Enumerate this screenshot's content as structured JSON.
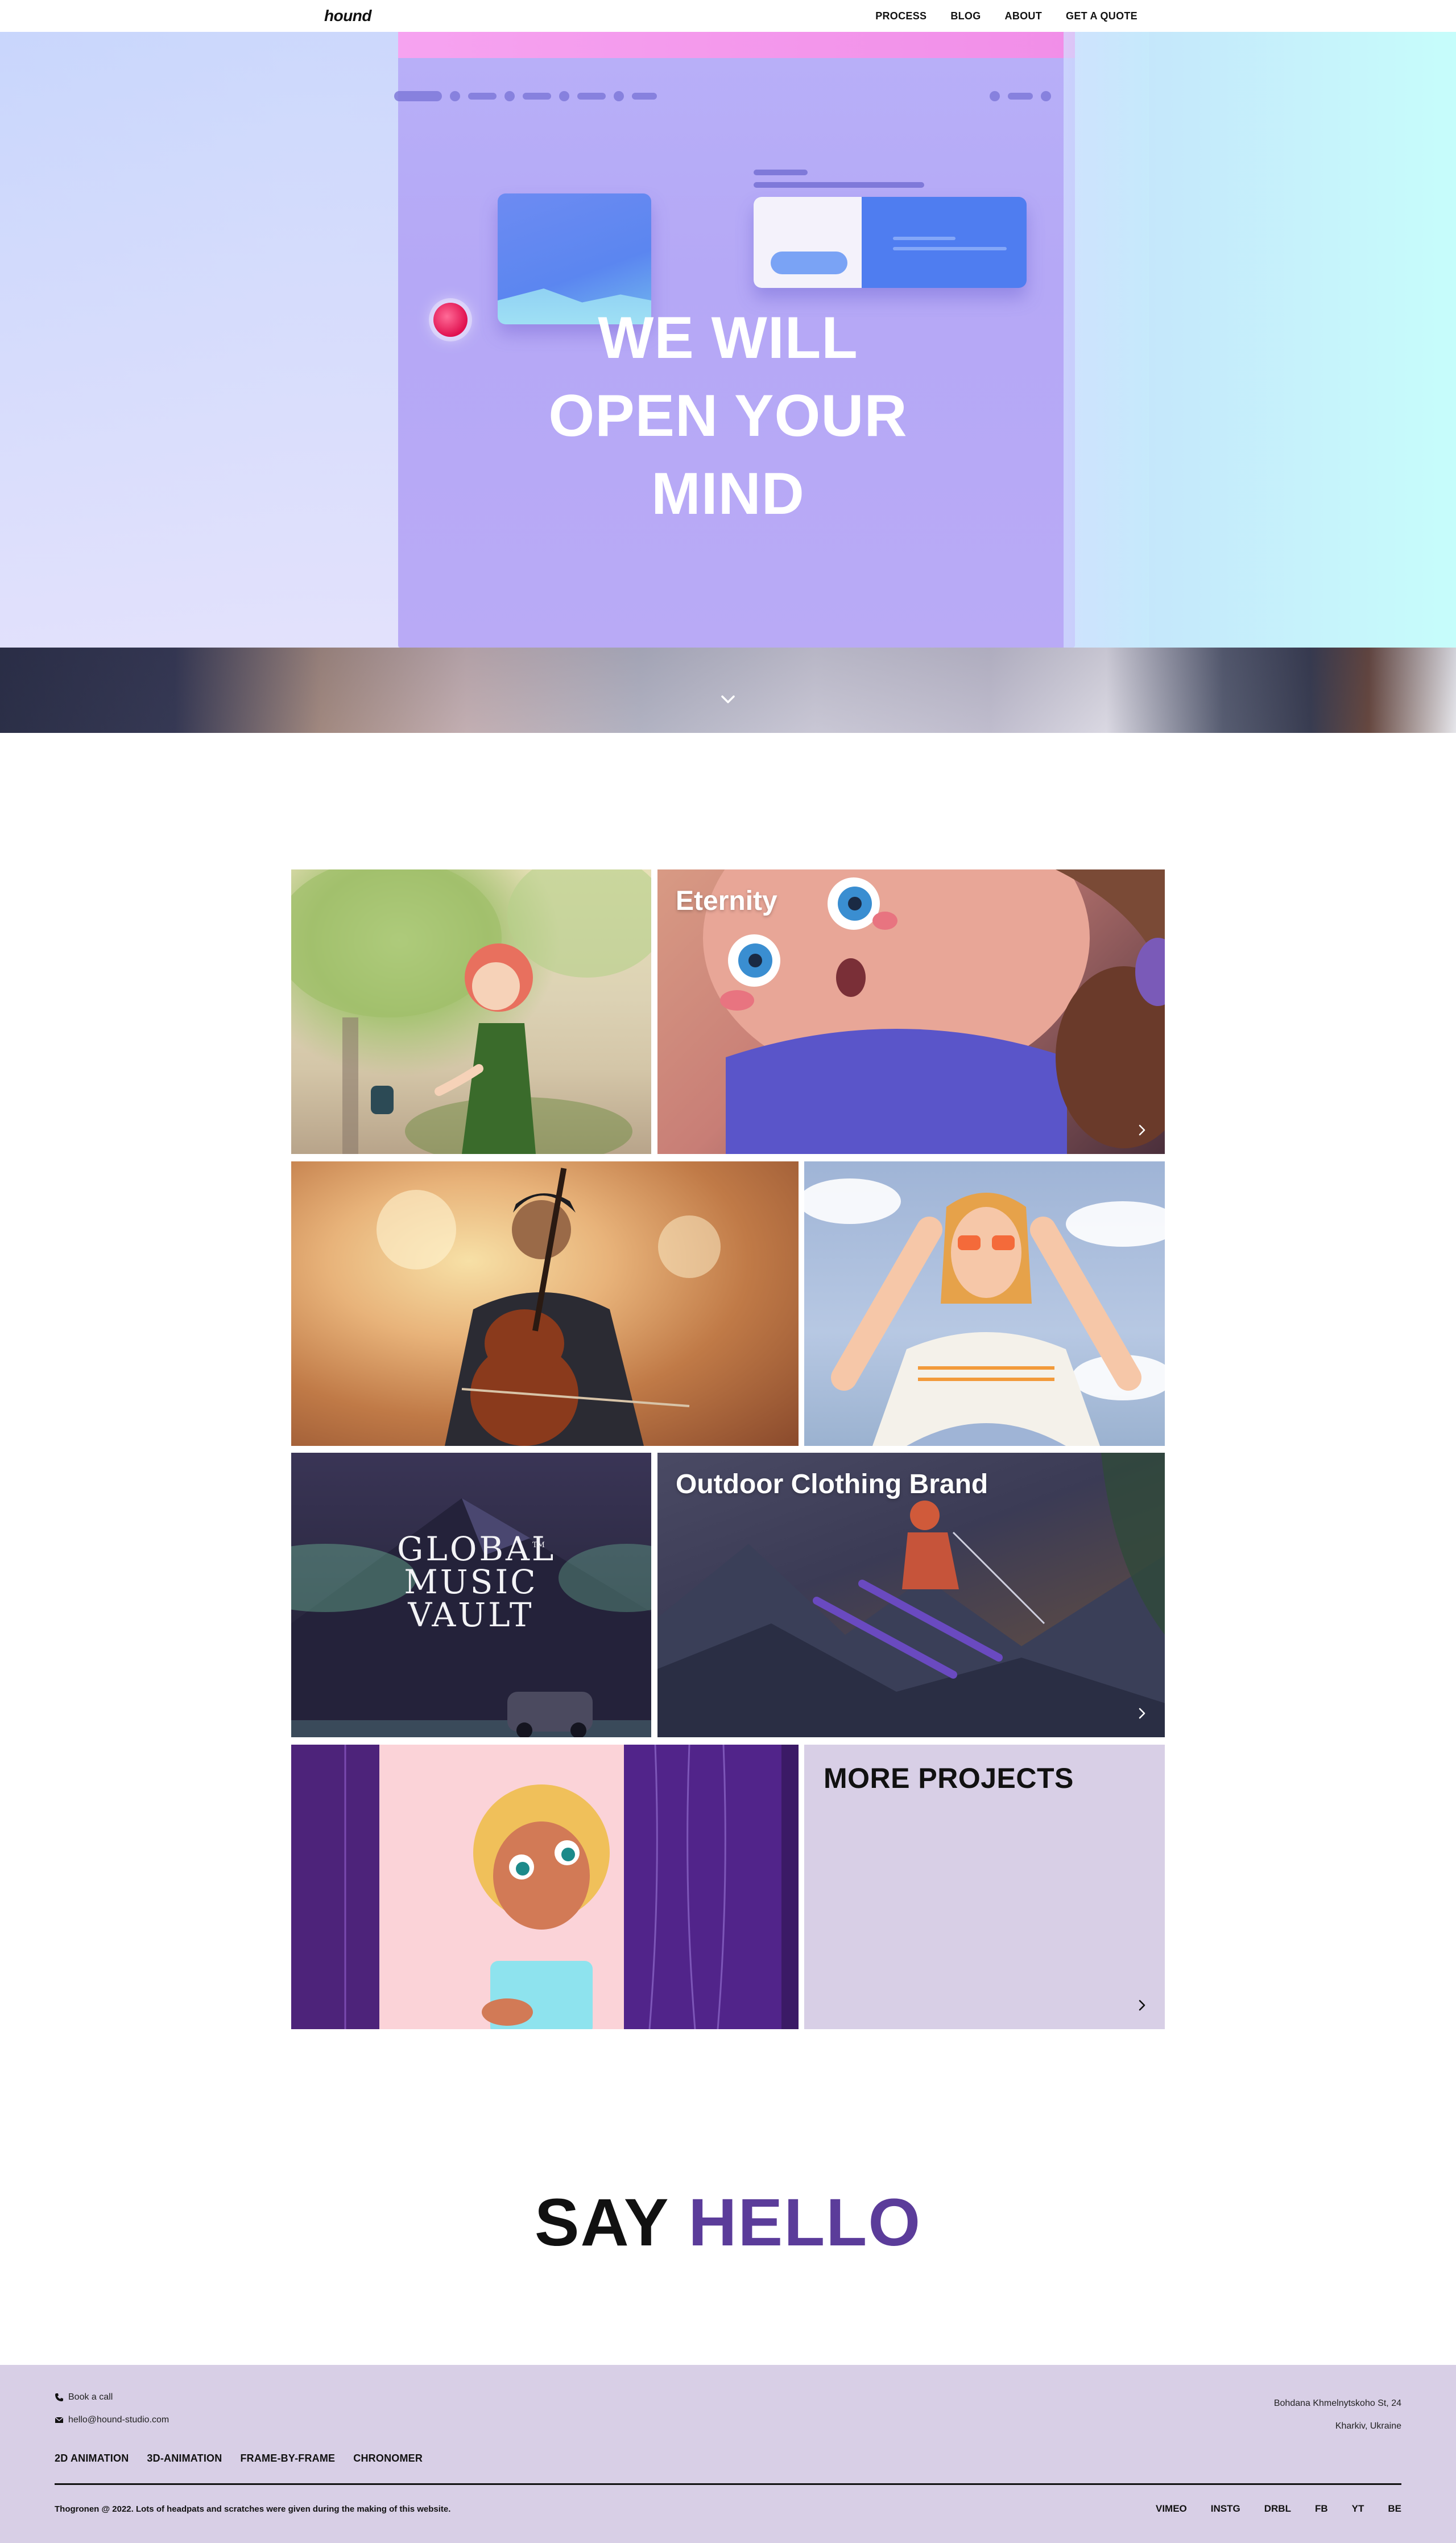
{
  "nav": {
    "logo": "hound",
    "links": [
      "PROCESS",
      "BLOG",
      "ABOUT",
      "GET A QUOTE"
    ]
  },
  "hero": {
    "title_lines": [
      "WE WILL",
      "OPEN YOUR",
      "MIND"
    ],
    "scroll_icon": "chevron-down-icon"
  },
  "projects": {
    "tiles": [
      {
        "title": "",
        "arrow": false
      },
      {
        "title": "Eternity",
        "arrow": true
      },
      {
        "title": "",
        "arrow": false
      },
      {
        "title": "",
        "arrow": false
      },
      {
        "title": "",
        "arrow": false,
        "logo_text": [
          "GLOBAL",
          "MUSIC",
          "VAULT"
        ],
        "logo_mark": "TM"
      },
      {
        "title": "Outdoor Clothing Brand",
        "arrow": true
      },
      {
        "title": "",
        "arrow": false
      },
      {
        "title": "MORE PROJECTS",
        "arrow": true
      }
    ]
  },
  "say_hello": {
    "word1": "SAY",
    "word2": "HELLO"
  },
  "footer": {
    "contact": {
      "call": "Book a call",
      "email": "hello@hound-studio.com"
    },
    "address": {
      "line1": "Bohdana Khmelnytskoho St, 24",
      "line2": "Kharkiv, Ukraine"
    },
    "services": [
      "2D ANIMATION",
      "3D-ANIMATION",
      "FRAME-BY-FRAME",
      "CHRONOMER"
    ],
    "copyright": "Thogronen @ 2022. Lots of headpats and scratches were given during the making of this website.",
    "social": [
      "VIMEO",
      "INSTG",
      "DRBL",
      "FB",
      "YT",
      "BE"
    ]
  },
  "colors": {
    "accent": "#5b3c9a",
    "footer_bg": "#d8cfe6",
    "more_projects_bg": "#d8cfe6"
  }
}
